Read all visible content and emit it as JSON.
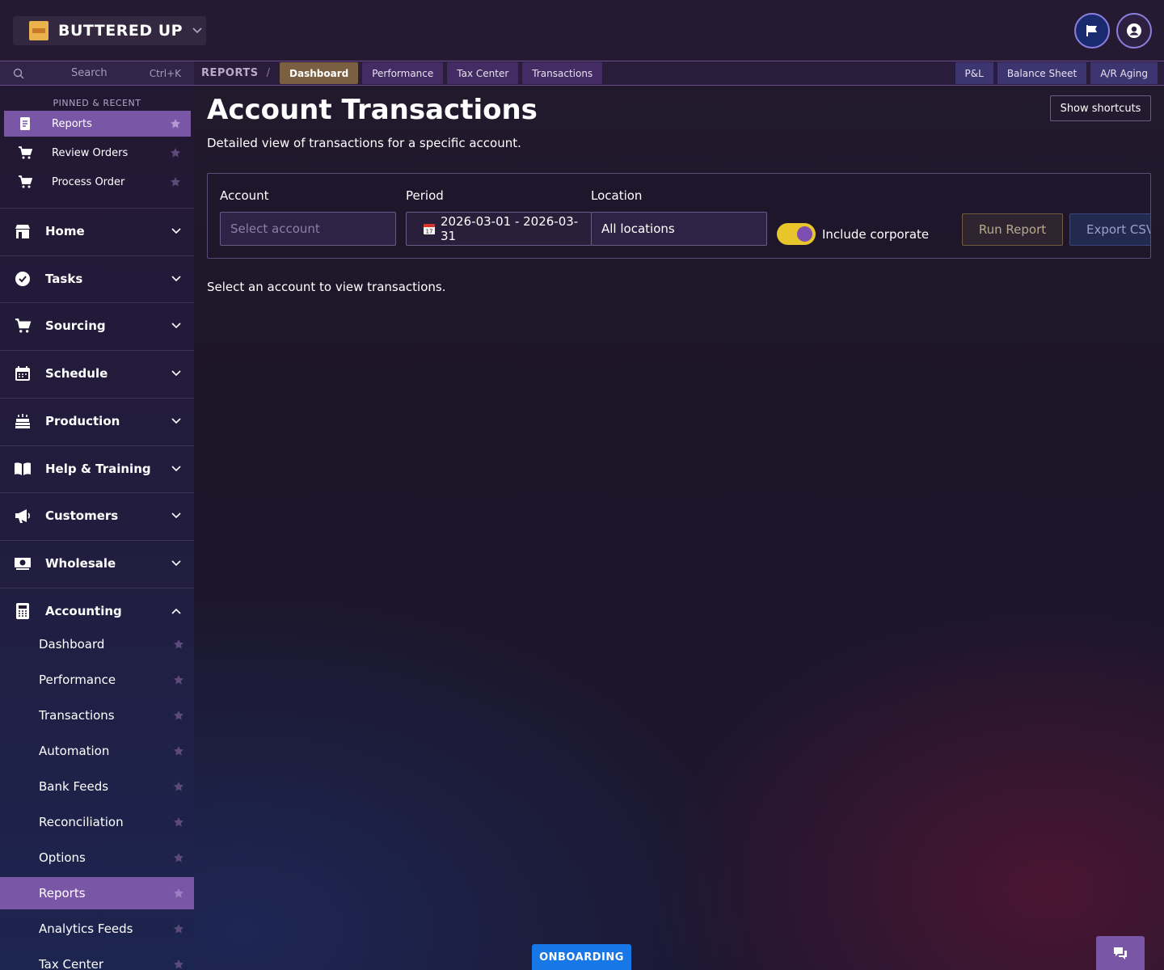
{
  "app": {
    "brand_name": "BUTTERED UP"
  },
  "nav": {
    "search_placeholder": "Search",
    "search_shortcut": "Ctrl+K",
    "breadcrumb_root": "REPORTS",
    "breadcrumb_separator": "/",
    "tabs": [
      {
        "label": "Dashboard",
        "active": true
      },
      {
        "label": "Performance",
        "active": false
      },
      {
        "label": "Tax Center",
        "active": false
      },
      {
        "label": "Transactions",
        "active": false
      }
    ],
    "right_tabs": [
      {
        "label": "P&L"
      },
      {
        "label": "Balance Sheet"
      },
      {
        "label": "A/R Aging"
      }
    ]
  },
  "sidebar": {
    "pinned_title": "PINNED & RECENT",
    "pinned": [
      {
        "label": "Reports",
        "icon": "report-icon",
        "active": true
      },
      {
        "label": "Review Orders",
        "icon": "cart-icon",
        "active": false
      },
      {
        "label": "Process Order",
        "icon": "cart-icon",
        "active": false
      }
    ],
    "sections": [
      {
        "label": "Home",
        "icon": "store-icon"
      },
      {
        "label": "Tasks",
        "icon": "check-badge-icon"
      },
      {
        "label": "Sourcing",
        "icon": "cart-icon"
      },
      {
        "label": "Schedule",
        "icon": "calendar-icon"
      },
      {
        "label": "Production",
        "icon": "cake-icon"
      },
      {
        "label": "Help & Training",
        "icon": "book-icon"
      },
      {
        "label": "Customers",
        "icon": "megaphone-icon"
      },
      {
        "label": "Wholesale",
        "icon": "money-icon"
      },
      {
        "label": "Accounting",
        "icon": "calculator-icon",
        "expanded": true
      }
    ],
    "accounting_items": [
      {
        "label": "Dashboard",
        "active": false
      },
      {
        "label": "Performance",
        "active": false
      },
      {
        "label": "Transactions",
        "active": false
      },
      {
        "label": "Automation",
        "active": false
      },
      {
        "label": "Bank Feeds",
        "active": false
      },
      {
        "label": "Reconciliation",
        "active": false
      },
      {
        "label": "Options",
        "active": false
      },
      {
        "label": "Reports",
        "active": true
      },
      {
        "label": "Analytics Feeds",
        "active": false
      },
      {
        "label": "Tax Center",
        "active": false
      }
    ]
  },
  "main": {
    "title": "Account Transactions",
    "subtitle": "Detailed view of transactions for a specific account.",
    "shortcuts_label": "Show shortcuts",
    "filters": {
      "account_label": "Account",
      "account_placeholder": "Select account",
      "period_label": "Period",
      "period_value": "2026-03-01 - 2026-03-31",
      "location_label": "Location",
      "location_value": "All locations",
      "include_corporate_label": "Include corporate",
      "include_corporate_on": true,
      "run_label": "Run Report",
      "export_label": "Export CSV"
    },
    "empty_message": "Select an account to view transactions."
  },
  "footer": {
    "onboarding_label": "ONBOARDING"
  },
  "colors": {
    "accent_purple": "#7a56a6",
    "toggle_yellow": "#e8c52a",
    "onboarding_blue": "#1877e6",
    "active_tab": "#7a6040"
  }
}
